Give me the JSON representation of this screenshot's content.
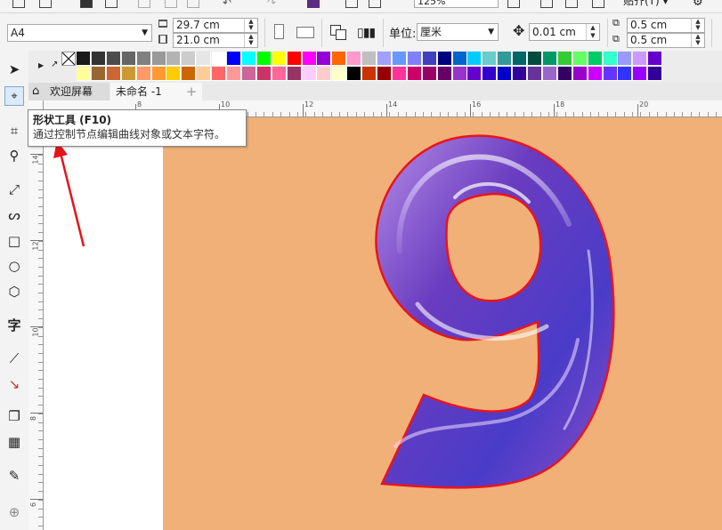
{
  "topbar": {
    "zoom_value": "125%",
    "snap_label": "贴齐(T)"
  },
  "propbar": {
    "page_size": "A4",
    "width": "29.7 cm",
    "height": "21.0 cm",
    "unit_label": "单位:",
    "unit_value": "厘米",
    "nudge": "0.01 cm",
    "dup_x": "0.5 cm",
    "dup_y": "0.5 cm"
  },
  "tabs": {
    "welcome": "欢迎屏幕",
    "document": "未命名 -1",
    "add": "+"
  },
  "hruler_labels": [
    "8",
    "10",
    "12",
    "14",
    "16",
    "18",
    "20"
  ],
  "vruler_labels": [
    "14",
    "12",
    "10",
    "8",
    "6"
  ],
  "tooltip": {
    "title": "形状工具 (F10)",
    "description": "通过控制节点编辑曲线对象或文本字符。"
  },
  "tools": {
    "pick": "pick-tool",
    "shape": "shape-tool",
    "crop": "crop-tool",
    "zoom": "zoom-tool",
    "freehand": "freehand-tool",
    "artistic": "artistic-media-tool",
    "rectangle": "rectangle-tool",
    "ellipse": "ellipse-tool",
    "polygon": "polygon-tool",
    "text": "字",
    "dimension": "dimension-tool",
    "connector": "connector-tool",
    "shadow": "drop-shadow-tool",
    "transparency": "transparency-tool",
    "eyedropper": "eyedropper-tool",
    "add": "add-tool"
  },
  "palette_row1": [
    "#1a1a1a",
    "#333333",
    "#4d4d4d",
    "#666666",
    "#808080",
    "#999999",
    "#b3b3b3",
    "#cccccc",
    "#e6e6e6",
    "#ffffff",
    "#0000ff",
    "#00ffff",
    "#00ff00",
    "#ffff00",
    "#ff0000",
    "#ff00ff",
    "#9400d3",
    "#ff6600",
    "#ff99cc",
    "#bfbfbf",
    "#a0a0ff",
    "#6699ff",
    "#8080ff",
    "#4040c0",
    "#000080",
    "#0066cc",
    "#00ccff",
    "#66cccc",
    "#339999",
    "#006666",
    "#004d40",
    "#009966",
    "#33cc33",
    "#66ff66",
    "#00cc66",
    "#33ffcc",
    "#9999ff",
    "#cc99ff",
    "#6600cc"
  ],
  "palette_row2": [
    "#ffff99",
    "#996633",
    "#cc6633",
    "#cc9933",
    "#ff9966",
    "#ff9933",
    "#ffcc00",
    "#cc6600",
    "#ffcc99",
    "#ff6666",
    "#ff9999",
    "#cc6699",
    "#cc3366",
    "#ff6699",
    "#993366",
    "#ffccff",
    "#ffcccc",
    "#ffffcc",
    "#000000",
    "#cc3300",
    "#990000",
    "#ff3399",
    "#cc0066",
    "#990066",
    "#660066",
    "#9933cc",
    "#6600cc",
    "#3300cc",
    "#0000cc",
    "#330099",
    "#663399",
    "#9966cc",
    "#330066",
    "#9900cc",
    "#cc00ff",
    "#6633ff",
    "#3333ff",
    "#9900ff",
    "#330099"
  ],
  "accent_outline": "#e8141e",
  "artboard_color": "#f0b077",
  "glyph": "9"
}
